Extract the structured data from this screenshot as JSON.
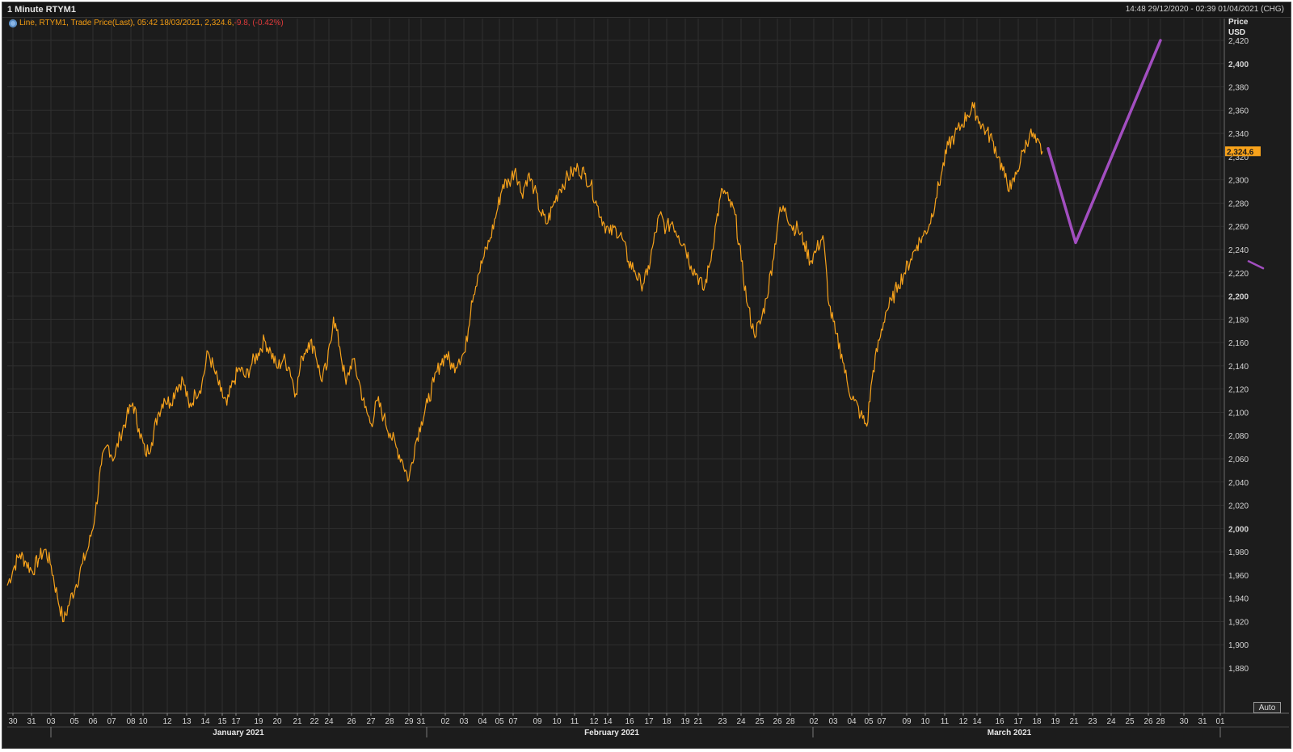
{
  "window": {
    "title": "1 Minute RTYM1",
    "date_range": "14:48 29/12/2020 - 02:39 01/04/2021 (CHG)"
  },
  "legend": {
    "text": "Line, RTYM1, Trade Price(Last), 05:42 18/03/2021, 2,324.6,",
    "change": " -9.8, (-0.42%)"
  },
  "axis": {
    "unit_line1": "Price",
    "unit_line2": "USD",
    "auto_button": "Auto"
  },
  "colors": {
    "background": "#1c1c1c",
    "grid": "#2f2f2f",
    "price_line": "#f7a21b",
    "annotation": "#a24ec0",
    "last_price_badge": "#f7a21b",
    "change_negative": "#e23b3b"
  },
  "chart_data": {
    "type": "line",
    "title": "1 Minute RTYM1",
    "ylabel": "Price USD",
    "ylim": [
      1865,
      2440
    ],
    "y_ticks": [
      {
        "value": 1880,
        "label": "1,880",
        "bold": false
      },
      {
        "value": 1900,
        "label": "1,900",
        "bold": false
      },
      {
        "value": 1920,
        "label": "1,920",
        "bold": false
      },
      {
        "value": 1940,
        "label": "1,940",
        "bold": false
      },
      {
        "value": 1960,
        "label": "1,960",
        "bold": false
      },
      {
        "value": 1980,
        "label": "1,980",
        "bold": false
      },
      {
        "value": 2000,
        "label": "2,000",
        "bold": true
      },
      {
        "value": 2020,
        "label": "2,020",
        "bold": false
      },
      {
        "value": 2040,
        "label": "2,040",
        "bold": false
      },
      {
        "value": 2060,
        "label": "2,060",
        "bold": false
      },
      {
        "value": 2080,
        "label": "2,080",
        "bold": false
      },
      {
        "value": 2100,
        "label": "2,100",
        "bold": false
      },
      {
        "value": 2120,
        "label": "2,120",
        "bold": false
      },
      {
        "value": 2140,
        "label": "2,140",
        "bold": false
      },
      {
        "value": 2160,
        "label": "2,160",
        "bold": false
      },
      {
        "value": 2180,
        "label": "2,180",
        "bold": false
      },
      {
        "value": 2200,
        "label": "2,200",
        "bold": true
      },
      {
        "value": 2220,
        "label": "2,220",
        "bold": false
      },
      {
        "value": 2240,
        "label": "2,240",
        "bold": false
      },
      {
        "value": 2260,
        "label": "2,260",
        "bold": false
      },
      {
        "value": 2280,
        "label": "2,280",
        "bold": false
      },
      {
        "value": 2300,
        "label": "2,300",
        "bold": false
      },
      {
        "value": 2320,
        "label": "2,320",
        "bold": false
      },
      {
        "value": 2340,
        "label": "2,340",
        "bold": false
      },
      {
        "value": 2360,
        "label": "2,360",
        "bold": false
      },
      {
        "value": 2380,
        "label": "2,380",
        "bold": false
      },
      {
        "value": 2400,
        "label": "2,400",
        "bold": true
      },
      {
        "value": 2420,
        "label": "2,420",
        "bold": false
      }
    ],
    "x_days": [
      "30",
      "31",
      "03",
      "05",
      "06",
      "07",
      "08",
      "10",
      "12",
      "13",
      "14",
      "15",
      "17",
      "19",
      "20",
      "21",
      "22",
      "24",
      "26",
      "27",
      "28",
      "29",
      "31",
      "02",
      "03",
      "04",
      "05",
      "07",
      "09",
      "10",
      "11",
      "12",
      "14",
      "16",
      "17",
      "18",
      "19",
      "21",
      "23",
      "24",
      "25",
      "26",
      "28",
      "02",
      "03",
      "04",
      "05",
      "07",
      "09",
      "10",
      "11",
      "12",
      "14",
      "16",
      "17",
      "18",
      "19",
      "21",
      "23",
      "24",
      "25",
      "26",
      "28",
      "30",
      "31",
      "01"
    ],
    "months": [
      "January 2021",
      "February 2021",
      "March 2021"
    ],
    "last_price": 2324.6,
    "last_price_label": "2,324.6",
    "series": [
      {
        "values": [
          1951,
          1966,
          1978,
          1971,
          1963,
          1974,
          1982,
          1968,
          1941,
          1920,
          1938,
          1952,
          1970,
          1985,
          2012,
          2055,
          2072,
          2060,
          2080,
          2095,
          2108,
          2086,
          2064,
          2074,
          2098,
          2112,
          2108,
          2122,
          2128,
          2104,
          2116,
          2124,
          2152,
          2136,
          2118,
          2106,
          2126,
          2138,
          2130,
          2142,
          2151,
          2162,
          2152,
          2138,
          2146,
          2138,
          2116,
          2148,
          2160,
          2156,
          2128,
          2140,
          2182,
          2156,
          2124,
          2146,
          2128,
          2104,
          2090,
          2110,
          2096,
          2082,
          2070,
          2058,
          2042,
          2072,
          2092,
          2108,
          2126,
          2142,
          2150,
          2138,
          2146,
          2152,
          2196,
          2218,
          2234,
          2250,
          2272,
          2296,
          2298,
          2310,
          2288,
          2304,
          2292,
          2272,
          2262,
          2278,
          2292,
          2300,
          2306,
          2310,
          2305,
          2296,
          2278,
          2264,
          2254,
          2258,
          2250,
          2230,
          2222,
          2210,
          2218,
          2246,
          2270,
          2258,
          2264,
          2252,
          2244,
          2226,
          2218,
          2205,
          2228,
          2264,
          2292,
          2282,
          2270,
          2230,
          2192,
          2168,
          2176,
          2198,
          2230,
          2270,
          2276,
          2260,
          2258,
          2246,
          2230,
          2240,
          2252,
          2192,
          2168,
          2150,
          2122,
          2110,
          2098,
          2088,
          2136,
          2162,
          2186,
          2196,
          2210,
          2220,
          2232,
          2244,
          2252,
          2262,
          2284,
          2308,
          2330,
          2338,
          2346,
          2356,
          2362,
          2350,
          2342,
          2334,
          2320,
          2302,
          2292,
          2308,
          2326,
          2340,
          2332,
          2324.6
        ]
      }
    ],
    "annotation": {
      "kind": "projection-line",
      "points": [
        {
          "x_day": "18 Mar 2021 pm",
          "y": 2327
        },
        {
          "x_day": "21 Mar 2021",
          "y": 2246
        },
        {
          "x_day": "28 Mar 2021",
          "y": 2420
        }
      ],
      "edge_stub": {
        "y_from": 2230,
        "y_to": 2226
      }
    }
  }
}
